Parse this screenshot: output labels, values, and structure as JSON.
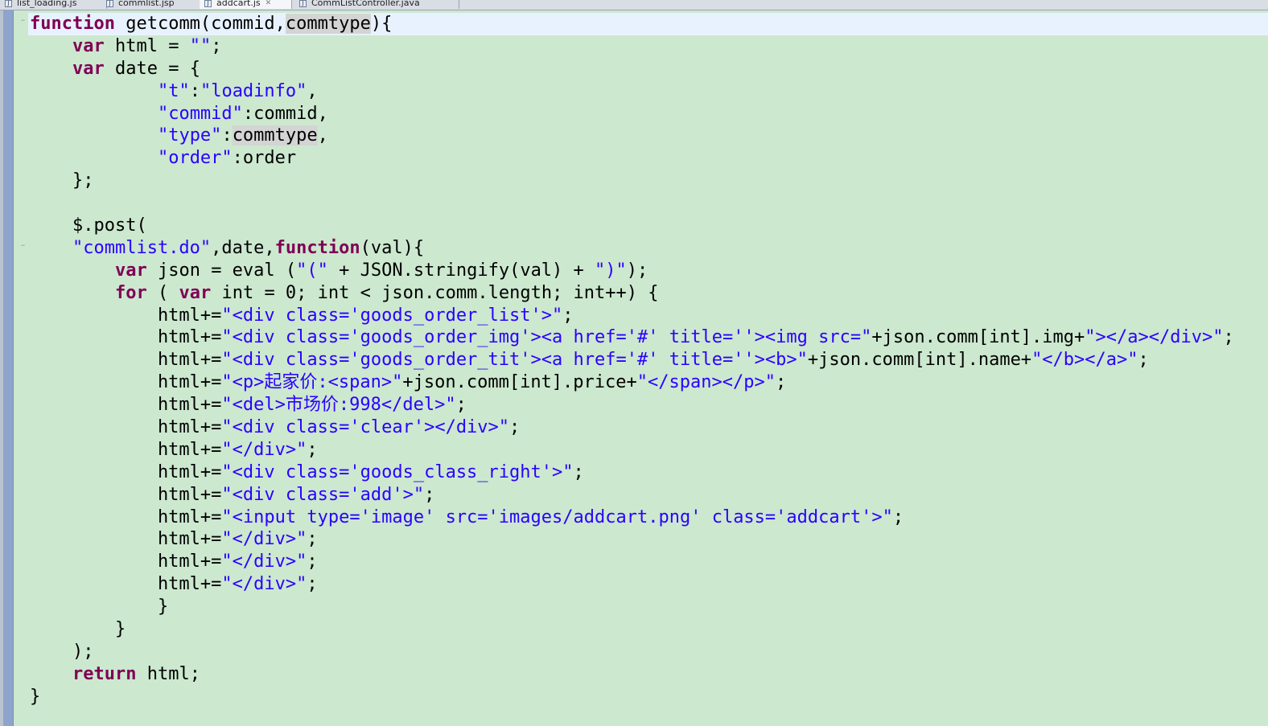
{
  "tabs": [
    {
      "label": "list_loading.js",
      "icon": "js-file-icon"
    },
    {
      "label": "commlist.jsp",
      "icon": "jsp-file-icon"
    },
    {
      "label": "addcart.js",
      "icon": "js-file-icon",
      "active": true
    },
    {
      "label": "CommListController.java",
      "icon": "java-file-icon"
    }
  ],
  "code_lines": [
    [
      {
        "t": "function",
        "c": "kw"
      },
      {
        "t": " getcomm(commid,"
      },
      {
        "t": "commtype",
        "c": "hl"
      },
      {
        "t": "){"
      }
    ],
    [
      {
        "t": "    "
      },
      {
        "t": "var",
        "c": "kw"
      },
      {
        "t": " html = "
      },
      {
        "t": "\"\"",
        "c": "str"
      },
      {
        "t": ";"
      }
    ],
    [
      {
        "t": "    "
      },
      {
        "t": "var",
        "c": "kw"
      },
      {
        "t": " date = {"
      }
    ],
    [
      {
        "t": "            "
      },
      {
        "t": "\"t\"",
        "c": "str"
      },
      {
        "t": ":"
      },
      {
        "t": "\"loadinfo\"",
        "c": "str"
      },
      {
        "t": ","
      }
    ],
    [
      {
        "t": "            "
      },
      {
        "t": "\"commid\"",
        "c": "str"
      },
      {
        "t": ":commid,"
      }
    ],
    [
      {
        "t": "            "
      },
      {
        "t": "\"type\"",
        "c": "str"
      },
      {
        "t": ":"
      },
      {
        "t": "commtype",
        "c": "hl"
      },
      {
        "t": ","
      }
    ],
    [
      {
        "t": "            "
      },
      {
        "t": "\"order\"",
        "c": "str"
      },
      {
        "t": ":order"
      }
    ],
    [
      {
        "t": "    };"
      }
    ],
    [
      {
        "t": ""
      }
    ],
    [
      {
        "t": "    $.post("
      }
    ],
    [
      {
        "t": "    "
      },
      {
        "t": "\"commlist.do\"",
        "c": "str"
      },
      {
        "t": ",date,"
      },
      {
        "t": "function",
        "c": "kw"
      },
      {
        "t": "(val){"
      }
    ],
    [
      {
        "t": "        "
      },
      {
        "t": "var",
        "c": "kw"
      },
      {
        "t": " json = eval ("
      },
      {
        "t": "\"(\"",
        "c": "str"
      },
      {
        "t": " + JSON.stringify(val) + "
      },
      {
        "t": "\")\"",
        "c": "str"
      },
      {
        "t": ");"
      }
    ],
    [
      {
        "t": "        "
      },
      {
        "t": "for",
        "c": "kw"
      },
      {
        "t": " ( "
      },
      {
        "t": "var",
        "c": "kw"
      },
      {
        "t": " int = 0; int < json.comm.length; int++) {"
      }
    ],
    [
      {
        "t": "            html+="
      },
      {
        "t": "\"<div class='goods_order_list'>\"",
        "c": "str"
      },
      {
        "t": ";"
      }
    ],
    [
      {
        "t": "            html+="
      },
      {
        "t": "\"<div class='goods_order_img'><a href='#' title=''><img src=\"",
        "c": "str"
      },
      {
        "t": "+json.comm[int].img+"
      },
      {
        "t": "\"></a></div>\"",
        "c": "str"
      },
      {
        "t": ";"
      }
    ],
    [
      {
        "t": "            html+="
      },
      {
        "t": "\"<div class='goods_order_tit'><a href='#' title=''><b>\"",
        "c": "str"
      },
      {
        "t": "+json.comm[int].name+"
      },
      {
        "t": "\"</b></a>\"",
        "c": "str"
      },
      {
        "t": ";"
      }
    ],
    [
      {
        "t": "            html+="
      },
      {
        "t": "\"<p>起家价:<span>\"",
        "c": "str"
      },
      {
        "t": "+json.comm[int].price+"
      },
      {
        "t": "\"</span></p>\"",
        "c": "str"
      },
      {
        "t": ";"
      }
    ],
    [
      {
        "t": "            html+="
      },
      {
        "t": "\"<del>市场价:998</del>\"",
        "c": "str"
      },
      {
        "t": ";"
      }
    ],
    [
      {
        "t": "            html+="
      },
      {
        "t": "\"<div class='clear'></div>\"",
        "c": "str"
      },
      {
        "t": ";"
      }
    ],
    [
      {
        "t": "            html+="
      },
      {
        "t": "\"</div>\"",
        "c": "str"
      },
      {
        "t": ";"
      }
    ],
    [
      {
        "t": "            html+="
      },
      {
        "t": "\"<div class='goods_class_right'>\"",
        "c": "str"
      },
      {
        "t": ";"
      }
    ],
    [
      {
        "t": "            html+="
      },
      {
        "t": "\"<div class='add'>\"",
        "c": "str"
      },
      {
        "t": ";"
      }
    ],
    [
      {
        "t": "            html+="
      },
      {
        "t": "\"<input type='image' src='images/addcart.png' class='addcart'>\"",
        "c": "str"
      },
      {
        "t": ";"
      }
    ],
    [
      {
        "t": "            html+="
      },
      {
        "t": "\"</div>\"",
        "c": "str"
      },
      {
        "t": ";"
      }
    ],
    [
      {
        "t": "            html+="
      },
      {
        "t": "\"</div>\"",
        "c": "str"
      },
      {
        "t": ";"
      }
    ],
    [
      {
        "t": "            html+="
      },
      {
        "t": "\"</div>\"",
        "c": "str"
      },
      {
        "t": ";"
      }
    ],
    [
      {
        "t": "            }"
      }
    ],
    [
      {
        "t": "        }"
      }
    ],
    [
      {
        "t": "    );"
      }
    ],
    [
      {
        "t": "    "
      },
      {
        "t": "return",
        "c": "kw"
      },
      {
        "t": " html;"
      }
    ],
    [
      {
        "t": "}"
      }
    ]
  ],
  "colors": {
    "editor_background": "#cce8cf",
    "current_line": "#e8f2fe",
    "keyword": "#7f0055",
    "string": "#2a00ff",
    "occurrence_highlight": "#d4d4d4",
    "change_ruler": "#8ea4cc"
  }
}
